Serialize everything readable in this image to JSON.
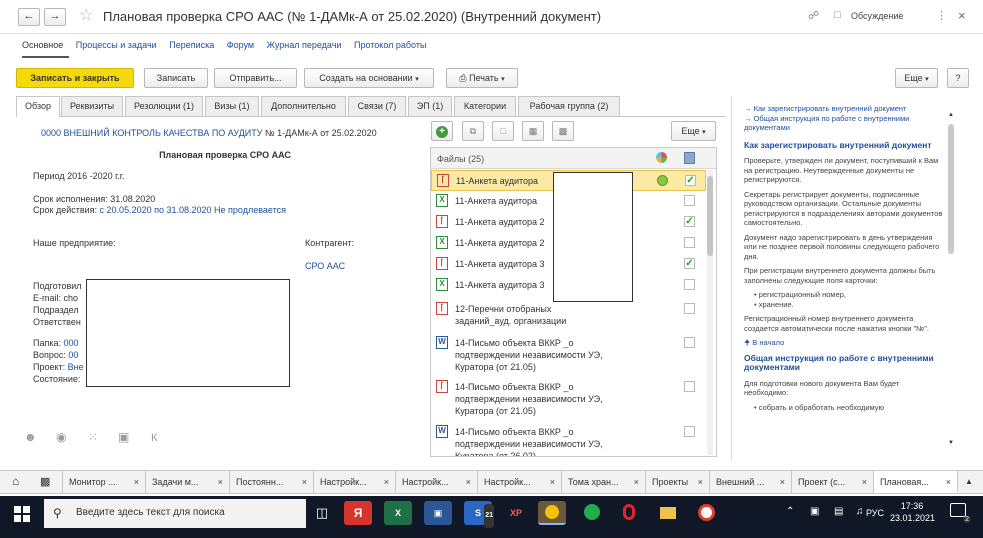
{
  "window": {
    "title": "Плановая проверка СРО ААС (№ 1-ДАМк-А от 25.02.2020) (Внутренний документ)",
    "discuss_label": "Обсуждение",
    "more_symbol": "⋮",
    "close_symbol": "×"
  },
  "section_tabs": [
    "Основное",
    "Процессы и задачи",
    "Переписка",
    "Форум",
    "Журнал передачи",
    "Протокол работы"
  ],
  "toolbar": {
    "save_close": "Записать и закрыть",
    "save": "Записать",
    "send": "Отправить...",
    "create_based": "Создать на основании",
    "print": "Печать",
    "more": "Еще",
    "help": "?"
  },
  "doc_tabs": [
    "Обзор",
    "Реквизиты",
    "Резолюции (1)",
    "Визы (1)",
    "Дополнительно",
    "Связи (7)",
    "ЭП (1)",
    "Категории",
    "Рабочая группа (2)"
  ],
  "overview": {
    "header_link": "0000 ВНЕШНИЙ КОНТРОЛЬ КАЧЕСТВА ПО АУДИТУ",
    "header_number": "№ 1-ДАМк-А от 25.02.2020",
    "doc_title": "Плановая проверка СРО ААС",
    "period": "Период 2016 -2020 г.г.",
    "due": "Срок исполнения: 31.08.2020",
    "validity_prefix": "Срок действия: ",
    "validity_link": "с 20.05.2020 по 31.08.2020 Не продлевается",
    "our_company": "Наше предприятие:",
    "counterparty": "Контрагент:",
    "counterparty_link": "СРО ААС",
    "prepared": "Подготовил",
    "email": "E-mail: cho",
    "dept": "Подраздел",
    "responsible": "Ответствен",
    "folder": "Папка: ",
    "folder_link": "000",
    "question": "Вопрос: ",
    "question_link": "00",
    "project": "Проект: ",
    "project_link": "Вне",
    "state": "Состояние:",
    "bottom_k": "К"
  },
  "files": {
    "header": "Файлы (25)",
    "more": "Еще",
    "items": [
      {
        "name": "11-Анкета аудитора",
        "type": "pdf",
        "checked": true,
        "selected": true
      },
      {
        "name": "11-Анкета аудитора",
        "type": "xl",
        "checked": false,
        "selected": false
      },
      {
        "name": "11-Анкета аудитора 2",
        "type": "pdf",
        "checked": true,
        "selected": false
      },
      {
        "name": "11-Анкета аудитора 2",
        "type": "xl",
        "checked": false,
        "selected": false
      },
      {
        "name": "11-Анкета аудитора 3",
        "type": "pdf",
        "checked": true,
        "selected": false
      },
      {
        "name": "11-Анкета аудитора 3",
        "type": "xl",
        "checked": false,
        "selected": false
      },
      {
        "name": "12-Перечни отобраных заданий_ауд. организации",
        "type": "pdf",
        "checked": false,
        "selected": false
      },
      {
        "name": "14-Письмо объекта ВККР _о подтверждении независимости УЭ, Куратора (от 21.05)",
        "type": "wd",
        "checked": false,
        "selected": false
      },
      {
        "name": "14-Письмо объекта ВККР _о подтверждении независимости УЭ, Куратора (от 21.05)",
        "type": "pdf",
        "checked": false,
        "selected": false
      },
      {
        "name": "14-Письмо объекта ВККР _о подтверждении независимости УЭ, Куратора (от 26.02)",
        "type": "wd",
        "checked": false,
        "selected": false
      }
    ]
  },
  "help": {
    "top_link1": "Как зарегистрировать внутренний документ",
    "top_link2": "Общая инструкция по работе с внутренними документами",
    "heading1": "Как зарегистрировать внутренний документ",
    "p1": "Проверьте, утвержден ли документ, поступивший к Вам на регистрацию. Неутвержденные документы не регистрируются.",
    "p2": "Секретарь регистрирует документы, подписанные руководством организации. Остальные документы регистрируются в подразделениях авторами документов самостоятельно.",
    "p3": "Документ надо зарегистрировать в день утверждения или не позднее первой половины следующего рабочего дня.",
    "p4": "При регистрации внутреннего документа должны быть заполнены следующие поля карточки:",
    "li1": "регистрационный номер,",
    "li2": "хранение.",
    "p5": "Регистрационный номер внутреннего документа создается автоматически после нажатия кнопки \"№\".",
    "back": "В начало",
    "heading2": "Общая инструкция по работе с внутренними документами",
    "p6": "Для подготовки нового документа Вам будет необходимо:",
    "li3": "собрать и обработать необходимую"
  },
  "open_tabs": [
    "Монитор ...",
    "Задачи м...",
    "Постоянн...",
    "Настройк...",
    "Настройк...",
    "Настройк...",
    "Тома хран...",
    "Проекты",
    "Внешний ...",
    "Проект (с...",
    "Плановая..."
  ],
  "taskbar": {
    "search_placeholder": "Введите здесь текст для поиска",
    "time": "17:36",
    "date": "23.01.2021",
    "lang": "РУС",
    "badge_s": "21",
    "badge_x": "XP",
    "badge_n": "2"
  }
}
